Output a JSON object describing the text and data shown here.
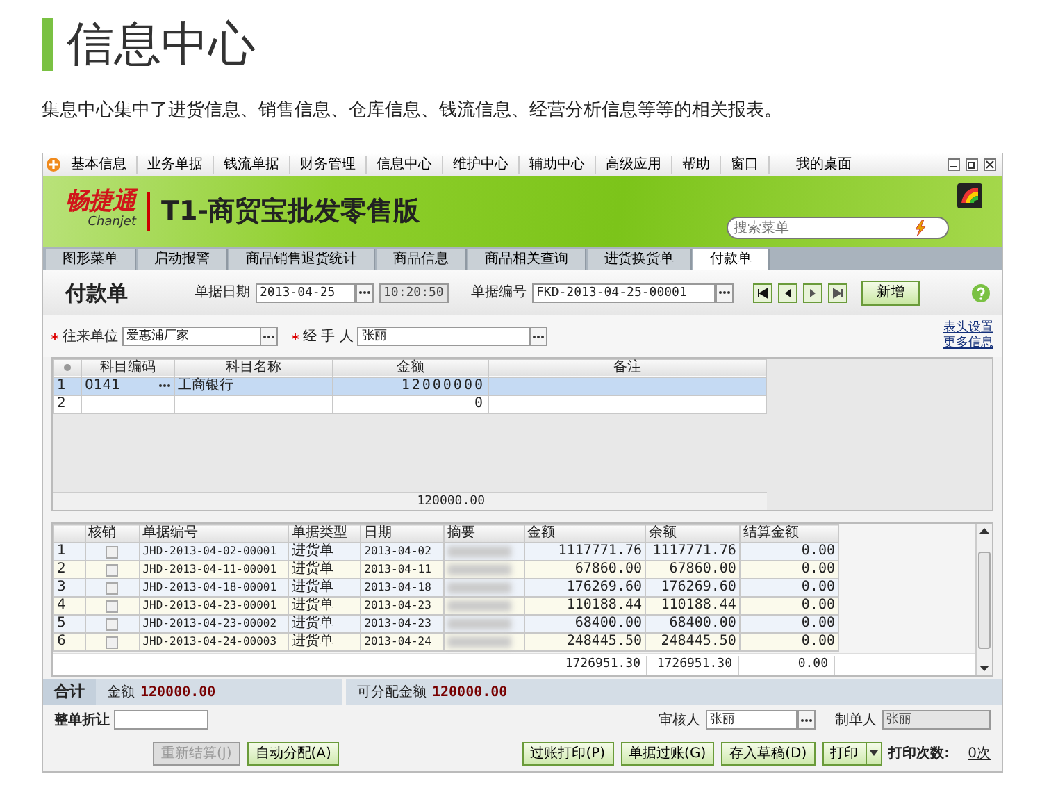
{
  "page": {
    "title": "信息中心",
    "description": "集息中心集中了进货信息、销售信息、仓库信息、钱流信息、经营分析信息等等的相关报表。"
  },
  "app": {
    "menu": [
      "基本信息",
      "业务单据",
      "钱流单据",
      "财务管理",
      "信息中心",
      "维护中心",
      "辅助中心",
      "高级应用",
      "帮助",
      "窗口",
      "我的桌面"
    ],
    "logo": {
      "name": "畅捷通",
      "sub": "Chanjet"
    },
    "product": "T1-商贸宝批发零售版",
    "search": {
      "placeholder": "搜索菜单"
    },
    "tabs": [
      {
        "label": "图形菜单",
        "selected": false
      },
      {
        "label": "启动报警",
        "selected": false
      },
      {
        "label": "商品销售退货统计",
        "selected": false
      },
      {
        "label": "商品信息",
        "selected": false
      },
      {
        "label": "商品相关查询",
        "selected": false
      },
      {
        "label": "进货换货单",
        "selected": false
      },
      {
        "label": "付款单",
        "selected": true
      }
    ],
    "form": {
      "title": "付款单",
      "date_label": "单据日期",
      "date": "2013-04-25",
      "time": "10:20:50",
      "number_label": "单据编号",
      "number": "FKD-2013-04-25-00001",
      "new_button": "新增",
      "partner_label": "往来单位",
      "partner": "爱惠浦厂家",
      "handler_label": "经 手 人",
      "handler": "张丽",
      "links": [
        "表头设置",
        "更多信息"
      ]
    },
    "entry_table": {
      "columns": [
        "科目编码",
        "科目名称",
        "金额",
        "备注"
      ],
      "rows": [
        {
          "index": "1",
          "code": "0141",
          "name": "工商银行",
          "amount": "12000000",
          "selected": true
        },
        {
          "index": "2",
          "amount": "0",
          "selected": false
        }
      ],
      "total": "120000.00"
    },
    "invoice_table": {
      "columns": [
        "核销",
        "单据编号",
        "单据类型",
        "日期",
        "摘要",
        "金额",
        "余额",
        "结算金额"
      ],
      "rows": [
        {
          "index": "1",
          "checked": false,
          "number": "JHD-2013-04-02-00001",
          "type": "进货单",
          "date": "2013-04-02",
          "amount": "1117771.76",
          "balance": "1117771.76",
          "settled": "0.00"
        },
        {
          "index": "2",
          "checked": false,
          "number": "JHD-2013-04-11-00001",
          "type": "进货单",
          "date": "2013-04-11",
          "amount": "67860.00",
          "balance": "67860.00",
          "settled": "0.00"
        },
        {
          "index": "3",
          "checked": false,
          "number": "JHD-2013-04-18-00001",
          "type": "进货单",
          "date": "2013-04-18",
          "amount": "176269.60",
          "balance": "176269.60",
          "settled": "0.00"
        },
        {
          "index": "4",
          "checked": false,
          "number": "JHD-2013-04-23-00001",
          "type": "进货单",
          "date": "2013-04-23",
          "amount": "110188.44",
          "balance": "110188.44",
          "settled": "0.00"
        },
        {
          "index": "5",
          "checked": false,
          "number": "JHD-2013-04-23-00002",
          "type": "进货单",
          "date": "2013-04-23",
          "amount": "68400.00",
          "balance": "68400.00",
          "settled": "0.00"
        },
        {
          "index": "6",
          "checked": false,
          "number": "JHD-2013-04-24-00003",
          "type": "进货单",
          "date": "2013-04-24",
          "amount": "248445.50",
          "balance": "248445.50",
          "settled": "0.00"
        }
      ],
      "totals": [
        "1726951.30",
        "1726951.30",
        "0.00"
      ]
    },
    "summary": {
      "label": "合计",
      "amount_label": "金额",
      "amount": "120000.00",
      "allocatable_label": "可分配金额",
      "allocatable": "120000.00"
    },
    "discount": {
      "label": "整单折让"
    },
    "reviewer": {
      "label": "审核人",
      "value": "张丽"
    },
    "maker": {
      "label": "制单人",
      "value": "张丽"
    },
    "buttons": [
      {
        "label": "重新结算(J)",
        "disabled": true
      },
      {
        "label": "自动分配(A)",
        "disabled": false
      },
      {
        "label": "过账打印(P)",
        "disabled": false
      },
      {
        "label": "单据过账(G)",
        "disabled": false
      },
      {
        "label": "存入草稿(D)",
        "disabled": false
      },
      {
        "label": "打印",
        "disabled": false
      }
    ],
    "print_count": {
      "label": "打印次数:",
      "value": "0次"
    }
  }
}
